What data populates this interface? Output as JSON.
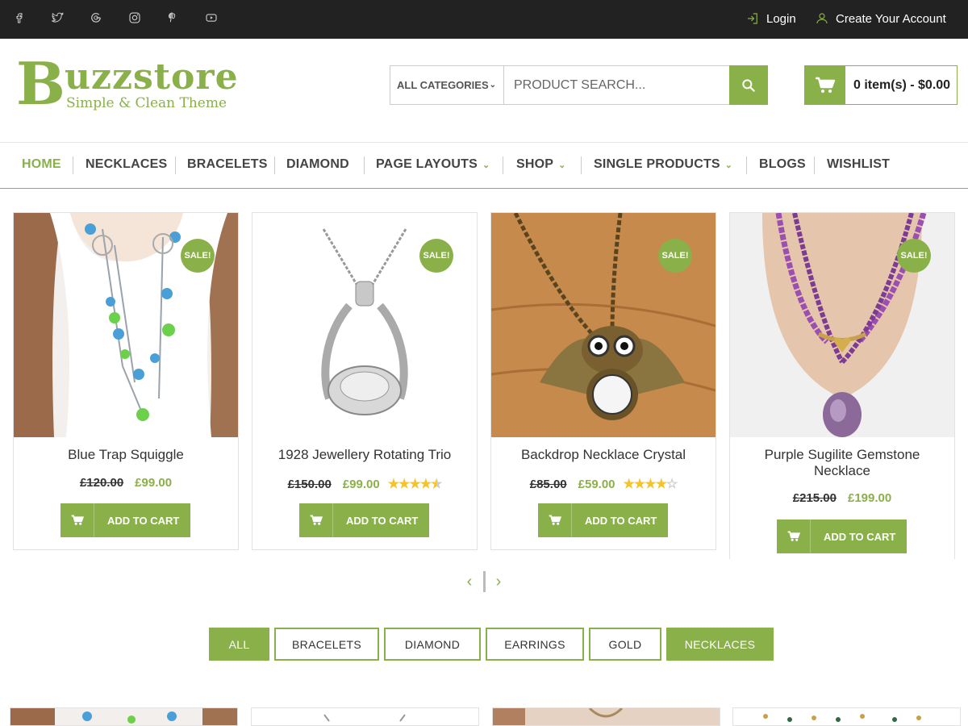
{
  "topbar": {
    "social_icons": [
      "facebook-icon",
      "twitter-icon",
      "google-icon",
      "instagram-icon",
      "pinterest-icon",
      "youtube-icon"
    ],
    "login_label": "Login",
    "account_label": "Create Your Account"
  },
  "brand": {
    "initial": "B",
    "name": "uzzstore",
    "tagline": "Simple & Clean Theme"
  },
  "search": {
    "category_label": "ALL CATEGORIES",
    "placeholder": "PRODUCT SEARCH..."
  },
  "cart": {
    "label": "0 item(s) - $0.00"
  },
  "nav": {
    "items": [
      {
        "label": "HOME"
      },
      {
        "label": "NECKLACES"
      },
      {
        "label": "BRACELETS"
      },
      {
        "label": "DIAMOND"
      },
      {
        "label": "PAGE LAYOUTS"
      },
      {
        "label": "SHOP"
      },
      {
        "label": "SINGLE PRODUCTS"
      },
      {
        "label": "BLOGS"
      },
      {
        "label": "WISHLIST"
      }
    ]
  },
  "products": [
    {
      "sale": "SALE!",
      "name": "Blue Trap Squiggle",
      "old_price": "£120.00",
      "price": "£99.00",
      "rating": null,
      "button": "ADD TO CART"
    },
    {
      "sale": "SALE!",
      "name": "1928 Jewellery Rotating Trio",
      "old_price": "£150.00",
      "price": "£99.00",
      "rating": 4.5,
      "button": "ADD TO CART"
    },
    {
      "sale": "SALE!",
      "name": "Backdrop Necklace Crystal",
      "old_price": "£85.00",
      "price": "£59.00",
      "rating": 4,
      "button": "ADD TO CART"
    },
    {
      "sale": "SALE!",
      "name": "Purple Sugilite Gemstone Necklace",
      "old_price": "£215.00",
      "price": "£199.00",
      "rating": null,
      "button": "ADD TO CART"
    }
  ],
  "filters": [
    {
      "label": "ALL",
      "active": true
    },
    {
      "label": "BRACELETS",
      "active": false
    },
    {
      "label": "DIAMOND",
      "active": false
    },
    {
      "label": "EARRINGS",
      "active": false
    },
    {
      "label": "GOLD",
      "active": false
    },
    {
      "label": "NECKLACES",
      "active": true
    }
  ],
  "colors": {
    "accent": "#8ab04a",
    "topbar": "#222222",
    "star": "#f3c430"
  }
}
